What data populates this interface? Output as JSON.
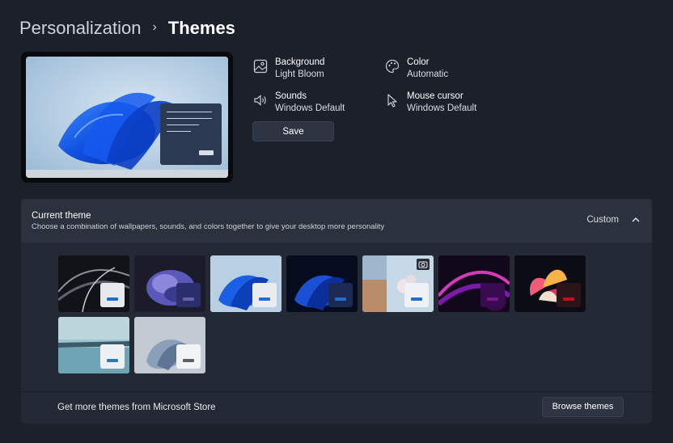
{
  "breadcrumb": {
    "parent": "Personalization",
    "separator": "›",
    "current": "Themes"
  },
  "properties": {
    "background": {
      "label": "Background",
      "value": "Light Bloom",
      "icon": "image-icon"
    },
    "color": {
      "label": "Color",
      "value": "Automatic",
      "icon": "palette-icon"
    },
    "sounds": {
      "label": "Sounds",
      "value": "Windows Default",
      "icon": "speaker-icon"
    },
    "mouse_cursor": {
      "label": "Mouse cursor",
      "value": "Windows Default",
      "icon": "cursor-icon"
    }
  },
  "save_label": "Save",
  "current_theme": {
    "title": "Current theme",
    "description": "Choose a combination of wallpapers, sounds, and colors together to give your desktop more personality",
    "state": "Custom",
    "themes": [
      {
        "name": "dark-abstract",
        "accent": "#1a6fcc"
      },
      {
        "name": "glow-purple",
        "accent": "#6a5fb0"
      },
      {
        "name": "windows-light",
        "accent": "#1f6ed0"
      },
      {
        "name": "windows-dark",
        "accent": "#1f6ed0"
      },
      {
        "name": "captured-motion",
        "accent": "#1f6ed0"
      },
      {
        "name": "flow-magenta",
        "accent": "#7a1a88"
      },
      {
        "name": "sunrise-flower",
        "accent": "#c21020"
      },
      {
        "name": "lake",
        "accent": "#2a7ab8"
      },
      {
        "name": "bloom-gray",
        "accent": "#5a5f68"
      }
    ]
  },
  "footer": {
    "text": "Get more themes from Microsoft Store",
    "browse_label": "Browse themes"
  }
}
